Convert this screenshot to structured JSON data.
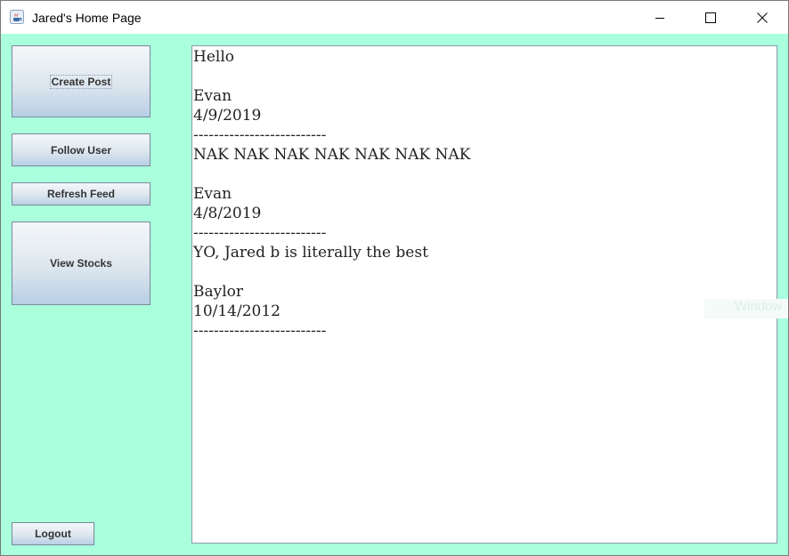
{
  "window": {
    "title": "Jared's Home Page",
    "app_icon": "java-coffee-icon",
    "controls": [
      "minimize-icon",
      "maximize-icon",
      "close-icon"
    ]
  },
  "colors": {
    "client_background": "#aaffdd",
    "feed_background": "#ffffff",
    "button_gradient_top": "#f4f7fa",
    "button_gradient_bottom": "#b8cfe5"
  },
  "sidebar": {
    "create_post": "Create Post",
    "follow_user": "Follow User",
    "refresh_feed": "Refresh Feed",
    "view_stocks": "View Stocks",
    "logout": "Logout"
  },
  "feed": {
    "lines": [
      "Hello",
      "",
      "Evan",
      "4/9/2019",
      "--------------------------",
      "NAK NAK NAK NAK NAK NAK NAK",
      "",
      "Evan",
      "4/8/2019",
      "--------------------------",
      "YO, Jared b is literally the best",
      "",
      "Baylor",
      "10/14/2012",
      "--------------------------"
    ]
  },
  "overlay": {
    "watermark_fragment": "Window"
  }
}
